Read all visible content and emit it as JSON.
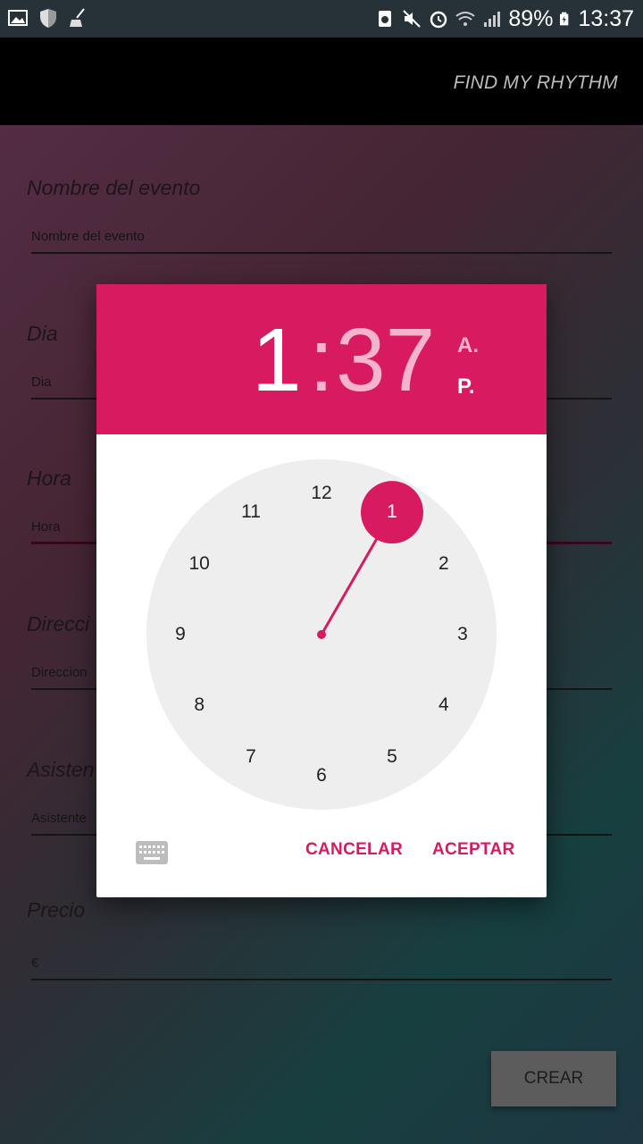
{
  "status_bar": {
    "left_icons": [
      "image-icon",
      "shield-icon",
      "broom-icon"
    ],
    "right_icons": [
      "recycle-icon",
      "mute-icon",
      "alarm-icon",
      "wifi-icon",
      "signal-icon",
      "battery-charging-icon"
    ],
    "battery": "89%",
    "time": "13:37"
  },
  "app_bar": {
    "title": "FIND MY RHYTHM"
  },
  "form": {
    "fields": [
      {
        "label": "Nombre del evento",
        "input": "Nombre del evento"
      },
      {
        "label": "Dia",
        "input": "Dia"
      },
      {
        "label": "Hora",
        "input": "Hora"
      },
      {
        "label": "Direcci",
        "input": "Direccion"
      },
      {
        "label": "Asisten",
        "input": "Asistente"
      },
      {
        "label": "Precio",
        "input": "€"
      }
    ],
    "crear_label": "CREAR"
  },
  "dialog": {
    "hour": "1",
    "colon": ":",
    "minute": "37",
    "am": "A.",
    "pm": "P.",
    "selected_period": "P.",
    "clock_numbers": [
      "12",
      "1",
      "2",
      "3",
      "4",
      "5",
      "6",
      "7",
      "8",
      "9",
      "10",
      "11"
    ],
    "selected_hour": "1",
    "keyboard_icon": "keyboard-icon",
    "cancel_label": "CANCELAR",
    "ok_label": "ACEPTAR",
    "accent_color": "#d81b60"
  }
}
